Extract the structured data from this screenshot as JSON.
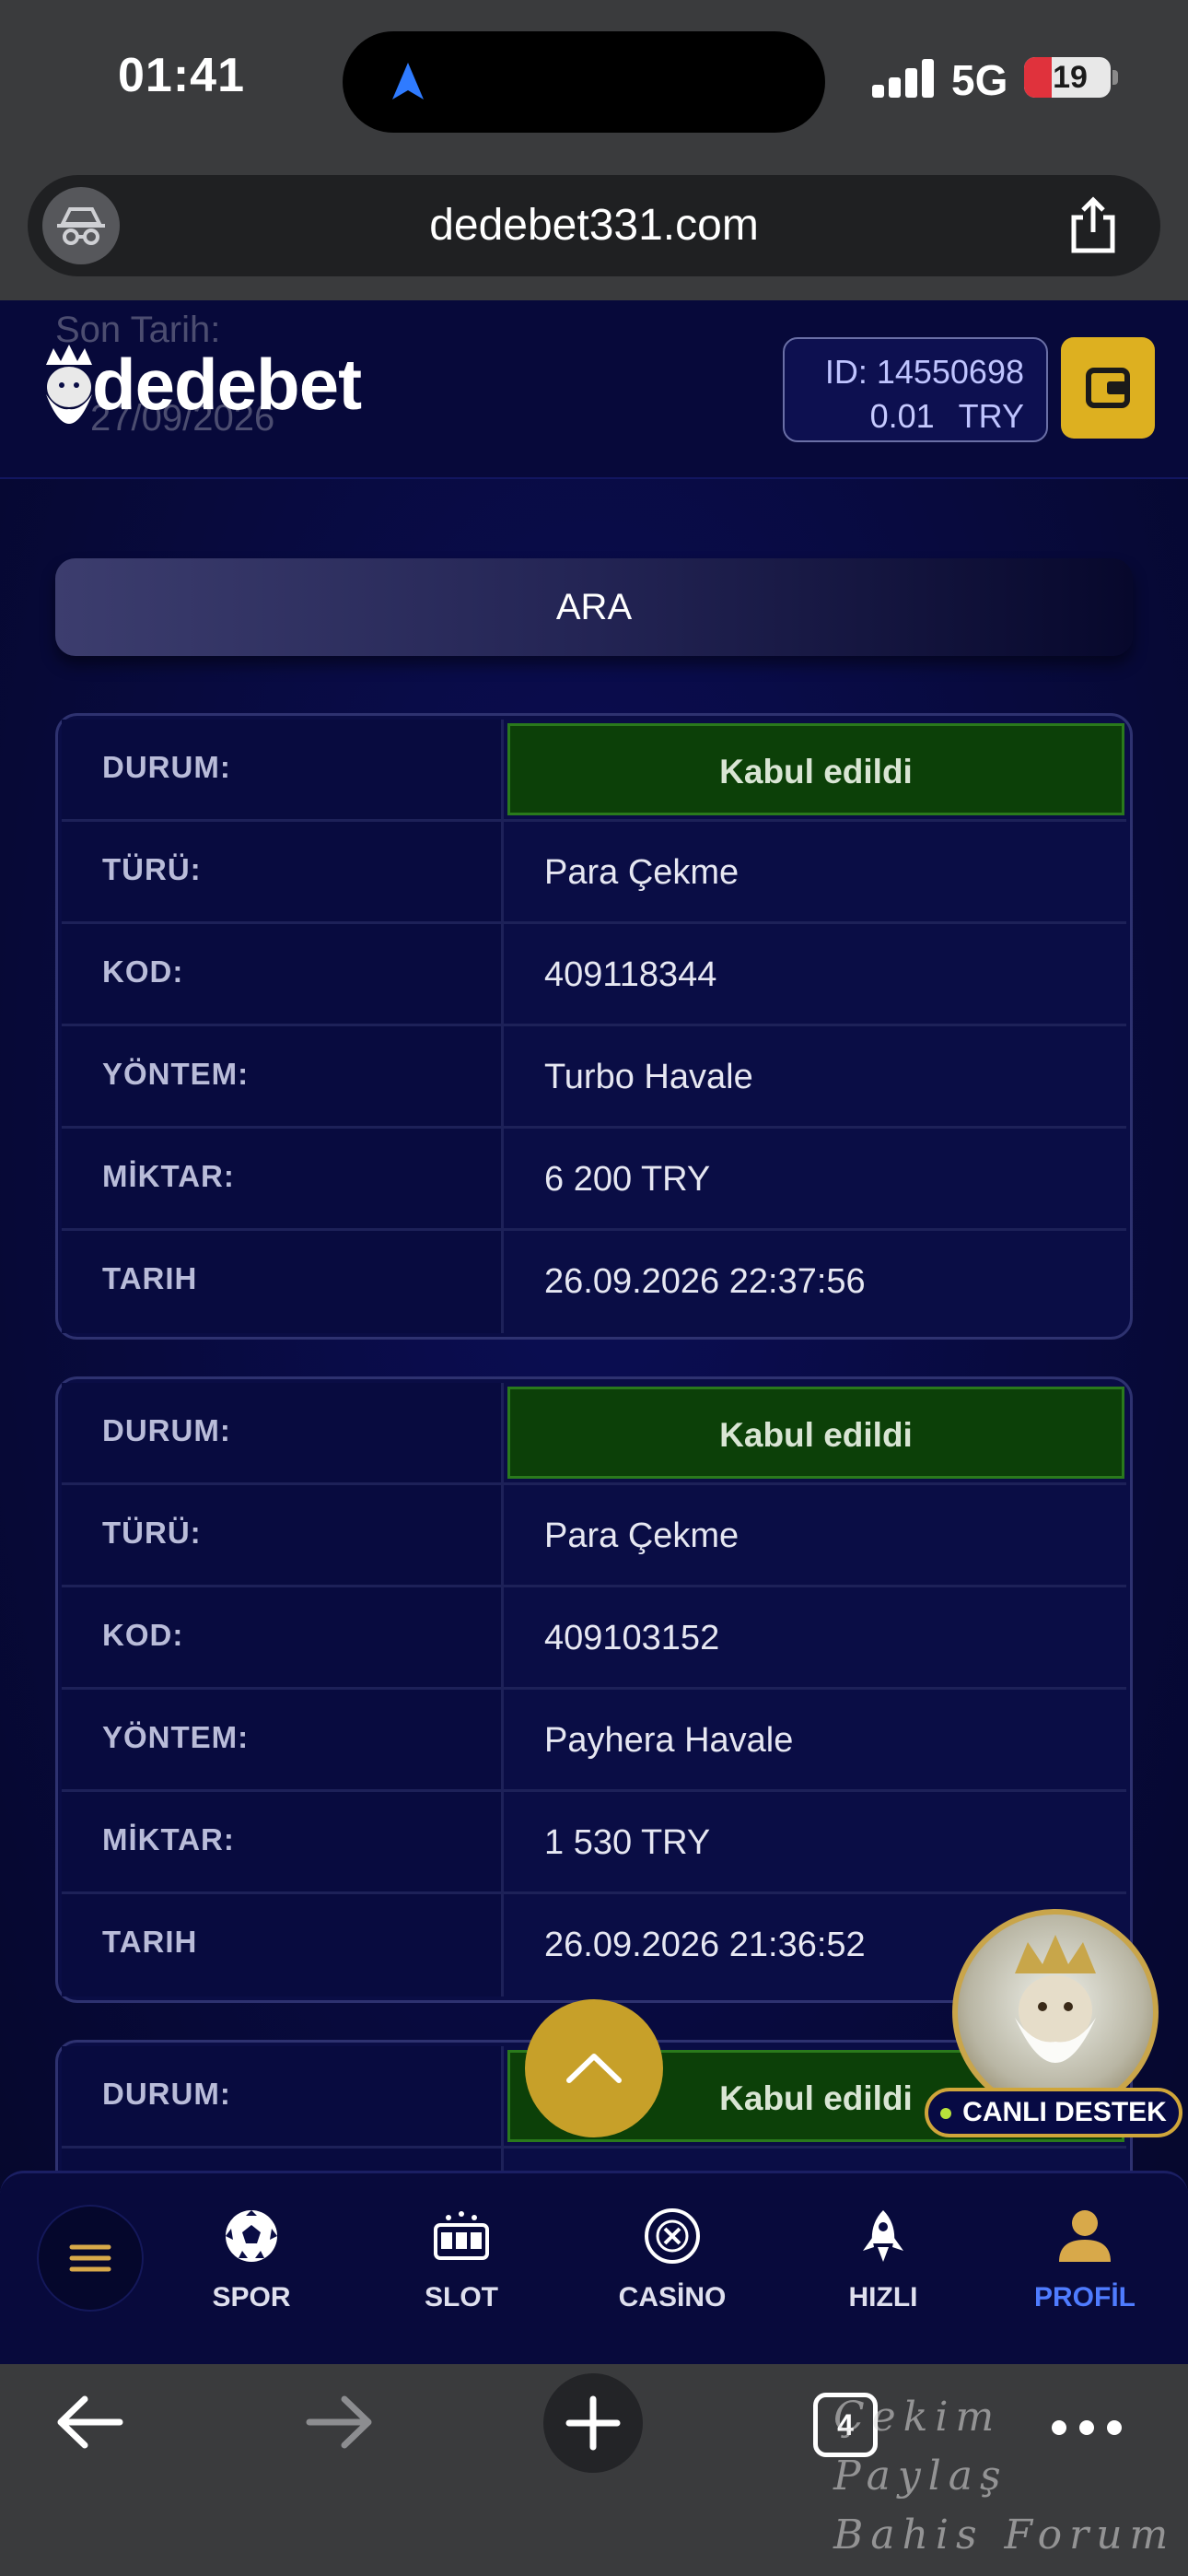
{
  "status_bar": {
    "time": "01:41",
    "network": "5G",
    "battery": "19"
  },
  "browser": {
    "url": "dedebet331.com",
    "tabs_count": "4"
  },
  "header": {
    "ghost_label": "Son Tarih:",
    "ghost_date": "27/09/2026",
    "logo": "dedebet",
    "account_id": "ID: 14550698",
    "balance": "0.01",
    "currency": "TRY"
  },
  "search_button": "ARA",
  "field_labels": {
    "status": "DURUM:",
    "type": "TÜRÜ:",
    "code": "KOD:",
    "method": "YÖNTEM:",
    "amount": "MİKTAR:",
    "date": "TARIH"
  },
  "transactions": [
    {
      "status": "Kabul edildi",
      "type": "Para Çekme",
      "code": "409118344",
      "method": "Turbo Havale",
      "amount": "6 200 TRY",
      "date": "26.09.2026 22:37:56"
    },
    {
      "status": "Kabul edildi",
      "type": "Para Çekme",
      "code": "409103152",
      "method": "Payhera Havale",
      "amount": "1 530 TRY",
      "date": "26.09.2026 21:36:52"
    },
    {
      "status": "Kabul edildi"
    }
  ],
  "support": {
    "label": "CANLI DESTEK"
  },
  "bottom_nav": [
    {
      "label": "SPOR",
      "icon": "soccer-ball-icon"
    },
    {
      "label": "SLOT",
      "icon": "slot-machine-icon"
    },
    {
      "label": "CASİNO",
      "icon": "casino-chip-icon"
    },
    {
      "label": "HIZLI",
      "icon": "rocket-icon"
    },
    {
      "label": "PROFİL",
      "icon": "user-icon",
      "active": true
    }
  ],
  "watermark": {
    "line1": "Çekim Paylaş",
    "line2": "Bahis Forum"
  },
  "colors": {
    "accent_gold": "#ddb020",
    "status_green": "#0c4008",
    "active_nav": "#4f7cff",
    "app_bg": "#080a40"
  }
}
